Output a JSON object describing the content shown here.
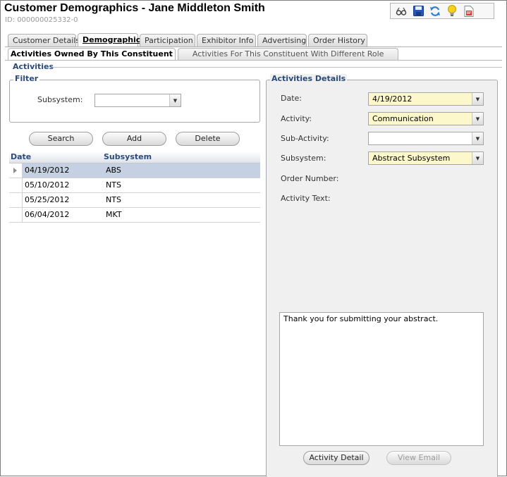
{
  "window": {
    "title": "Customer Demographics - Jane Middleton Smith",
    "id_text": "ID: 000000025332-0"
  },
  "toolbar": {
    "icons": [
      "glasses-icon",
      "save-icon",
      "refresh-icon",
      "lightbulb-icon",
      "report-icon"
    ]
  },
  "tabs": [
    {
      "label": "Customer Details",
      "active": false
    },
    {
      "label": "Demographics",
      "active": true
    },
    {
      "label": "Participation",
      "active": false
    },
    {
      "label": "Exhibitor Info",
      "active": false
    },
    {
      "label": "Advertising",
      "active": false
    },
    {
      "label": "Order History",
      "active": false
    }
  ],
  "subtabs": [
    {
      "label": "Activities Owned By This Constituent",
      "active": true
    },
    {
      "label": "Activities For This Constituent With Different Role",
      "active": false
    }
  ],
  "activities": {
    "legend": "Activities",
    "filter": {
      "legend": "Filter",
      "subsystem_label": "Subsystem:",
      "subsystem_value": ""
    },
    "buttons": {
      "search": "Search",
      "add": "Add",
      "delete": "Delete"
    },
    "grid": {
      "columns": [
        "Date",
        "Subsystem"
      ],
      "rows": [
        {
          "date": "04/19/2012",
          "subsystem": "ABS",
          "selected": true
        },
        {
          "date": "05/10/2012",
          "subsystem": "NTS",
          "selected": false
        },
        {
          "date": "05/25/2012",
          "subsystem": "NTS",
          "selected": false
        },
        {
          "date": "06/04/2012",
          "subsystem": "MKT",
          "selected": false
        }
      ]
    }
  },
  "details": {
    "legend": "Activities Details",
    "date_label": "Date:",
    "date_value": "4/19/2012",
    "activity_label": "Activity:",
    "activity_value": "Communication",
    "subactivity_label": "Sub-Activity:",
    "subactivity_value": "",
    "subsystem_label": "Subsystem:",
    "subsystem_value": "Abstract Subsystem",
    "order_number_label": "Order Number:",
    "activity_text_label": "Activity Text:",
    "activity_text": "Thank you for submitting your abstract.",
    "activity_detail_button": "Activity Detail",
    "view_email_button": "View Email"
  },
  "colors": {
    "accent": "#2b4a7a",
    "required_field": "#fdf7cc",
    "selected_row": "#c5d0e2"
  }
}
